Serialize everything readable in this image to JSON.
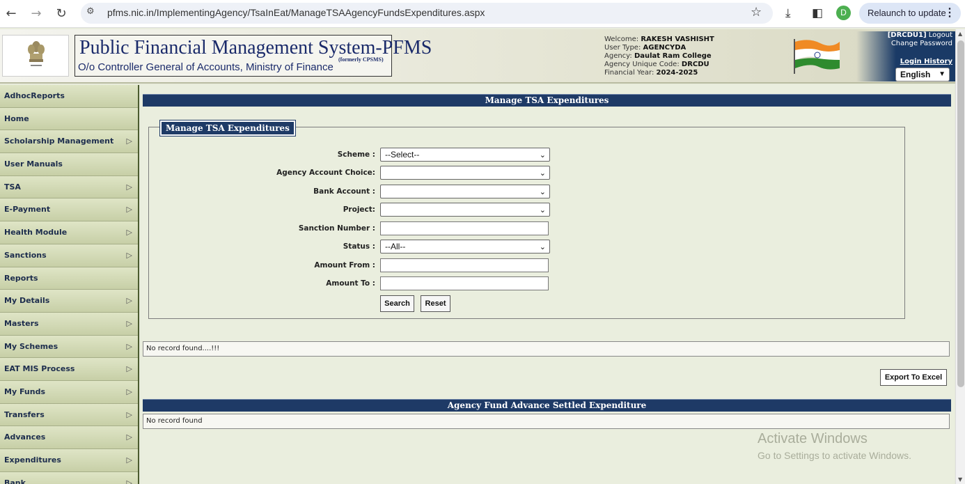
{
  "browser": {
    "url": "pfms.nic.in/ImplementingAgency/TsaInEat/ManageTSAAgencyFundsExpenditures.aspx",
    "profile_initial": "D",
    "relaunch_label": "Relaunch to update"
  },
  "header": {
    "title": "Public Financial Management System-PFMS",
    "formerly": "(formerly CPSMS)",
    "subtitle": "O/o Controller General of Accounts, Ministry of Finance",
    "welcome_label": "Welcome:",
    "welcome_name": "RAKESH VASHISHT",
    "user_type_label": "User Type:",
    "user_type": "AGENCYDA",
    "agency_label": "Agency:",
    "agency": "Daulat Ram College",
    "agency_code_label": "Agency Unique Code:",
    "agency_code": "DRCDU",
    "fy_label": "Financial Year:",
    "fy": "2024-2025",
    "user_id": "[DRCDU1]",
    "logout": "Logout",
    "change_password": "Change Password",
    "login_history": "Login History",
    "language": "English"
  },
  "sidebar": {
    "items": [
      {
        "label": "AdhocReports",
        "has_submenu": false
      },
      {
        "label": "Home",
        "has_submenu": false
      },
      {
        "label": "Scholarship Management",
        "has_submenu": true
      },
      {
        "label": "User Manuals",
        "has_submenu": false
      },
      {
        "label": "TSA",
        "has_submenu": true
      },
      {
        "label": "E-Payment",
        "has_submenu": true
      },
      {
        "label": "Health Module",
        "has_submenu": true
      },
      {
        "label": "Sanctions",
        "has_submenu": true
      },
      {
        "label": "Reports",
        "has_submenu": false
      },
      {
        "label": "My Details",
        "has_submenu": true
      },
      {
        "label": "Masters",
        "has_submenu": true
      },
      {
        "label": "My Schemes",
        "has_submenu": true
      },
      {
        "label": "EAT MIS Process",
        "has_submenu": true
      },
      {
        "label": "My Funds",
        "has_submenu": true
      },
      {
        "label": "Transfers",
        "has_submenu": true
      },
      {
        "label": "Advances",
        "has_submenu": true
      },
      {
        "label": "Expenditures",
        "has_submenu": true
      },
      {
        "label": "Bank",
        "has_submenu": true
      }
    ],
    "submenu_arrow": "▷"
  },
  "main": {
    "page_title": "Manage TSA Expenditures",
    "legend": "Manage TSA Expenditures",
    "form": {
      "scheme": {
        "label": "Scheme :",
        "value": "--Select--"
      },
      "agency_account_choice": {
        "label": "Agency Account Choice:",
        "value": ""
      },
      "bank_account": {
        "label": "Bank Account :",
        "value": ""
      },
      "project": {
        "label": "Project:",
        "value": ""
      },
      "sanction_number": {
        "label": "Sanction Number :",
        "value": ""
      },
      "status": {
        "label": "Status :",
        "value": "--All--"
      },
      "amount_from": {
        "label": "Amount From :",
        "value": ""
      },
      "amount_to": {
        "label": "Amount To :",
        "value": ""
      },
      "search_button": "Search",
      "reset_button": "Reset"
    },
    "no_record_1": "No record found....!!!",
    "export_button": "Export To Excel",
    "section2_title": "Agency Fund Advance Settled Expenditure",
    "no_record_2": "No record found"
  },
  "watermark": {
    "line1": "Activate Windows",
    "line2": "Go to Settings to activate Windows."
  },
  "colors": {
    "header_bar": "#1e3a66",
    "sidebar_bg": "#cdd4b0",
    "page_bg": "#eaeede"
  }
}
